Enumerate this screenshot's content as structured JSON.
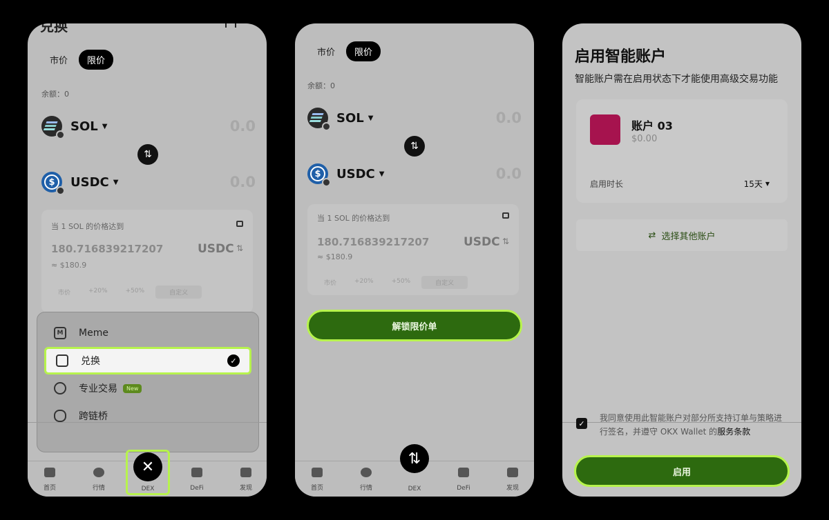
{
  "phone1": {
    "title_fragment": "兑换",
    "header_icon": "filter-icon",
    "tabs": [
      "市价",
      "限价"
    ],
    "balance": "余额：0",
    "from_token": {
      "name": "SOL",
      "amount": "0.0"
    },
    "to_token": {
      "name": "USDC",
      "amount": "0.0"
    },
    "limit": {
      "title": "当 1 SOL 的价格达到",
      "price": "180.716839217207",
      "unit": "USDC",
      "approx": "≈ $180.9",
      "chips": [
        "市价",
        "+20%",
        "+50%",
        "自定义"
      ]
    },
    "menu": [
      {
        "label": "Meme",
        "icon": "meme-icon"
      },
      {
        "label": "兑换",
        "icon": "swap-grid-icon",
        "selected": true
      },
      {
        "label": "专业交易",
        "icon": "pro-trade-icon",
        "badge": "New"
      },
      {
        "label": "跨链桥",
        "icon": "bridge-icon"
      }
    ],
    "nav": [
      "首页",
      "行情",
      "DEX",
      "DeFi",
      "发现"
    ]
  },
  "phone2": {
    "tabs": [
      "市价",
      "限价"
    ],
    "balance": "余额：0",
    "from_token": {
      "name": "SOL",
      "amount": "0.0"
    },
    "to_token": {
      "name": "USDC",
      "amount": "0.0"
    },
    "limit": {
      "title": "当 1 SOL 的价格达到",
      "price": "180.716839217207",
      "unit": "USDC",
      "approx": "≈ $180.9",
      "chips": [
        "市价",
        "+20%",
        "+50%",
        "自定义"
      ]
    },
    "cta": "解锁限价单",
    "nav": [
      "首页",
      "行情",
      "DEX",
      "DeFi",
      "发现"
    ]
  },
  "phone3": {
    "title": "启用智能账户",
    "subtitle": "智能账户需在启用状态下才能使用高级交易功能",
    "account": {
      "name": "账户 03",
      "balance": "$0.00"
    },
    "duration_label": "启用时长",
    "duration_value": "15天",
    "other_account": "选择其他账户",
    "agreement_text": "我同意使用此智能账户对部分所支持订单与策略进行签名，并遵守 OKX Wallet 的",
    "agreement_link": "服务条款",
    "cta": "启用"
  },
  "colors": {
    "accent": "#b7f34d",
    "button_green": "#2d6a0f"
  }
}
